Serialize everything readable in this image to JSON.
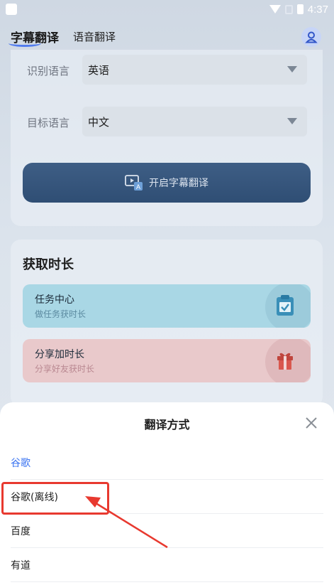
{
  "status_bar": {
    "time": "4:37"
  },
  "top_tabs": [
    {
      "label": "字幕翻译",
      "active": true
    },
    {
      "label": "语音翻译",
      "active": false
    }
  ],
  "profile": {
    "icon": "user-icon"
  },
  "settings_card": {
    "recognize_label": "识别语言",
    "recognize_value": "英语",
    "target_label": "目标语言",
    "target_value": "中文",
    "start_button": "开启字幕翻译"
  },
  "duration_card": {
    "title": "获取时长",
    "tasks": [
      {
        "title": "任务中心",
        "subtitle": "做任务获时长",
        "icon": "clipboard-check-icon"
      },
      {
        "title": "分享加时长",
        "subtitle": "分享好友获时长",
        "icon": "gift-icon"
      }
    ]
  },
  "translate_sheet": {
    "title": "翻译方式",
    "options": [
      {
        "label": "谷歌",
        "selected": true
      },
      {
        "label": "谷歌(离线)",
        "selected": false
      },
      {
        "label": "百度",
        "selected": false
      },
      {
        "label": "有道",
        "selected": false
      }
    ],
    "highlighted_option": "谷歌(离线)"
  },
  "colors": {
    "accent": "#3b74f1",
    "button": "#34557c",
    "annotation": "#e8392f"
  }
}
